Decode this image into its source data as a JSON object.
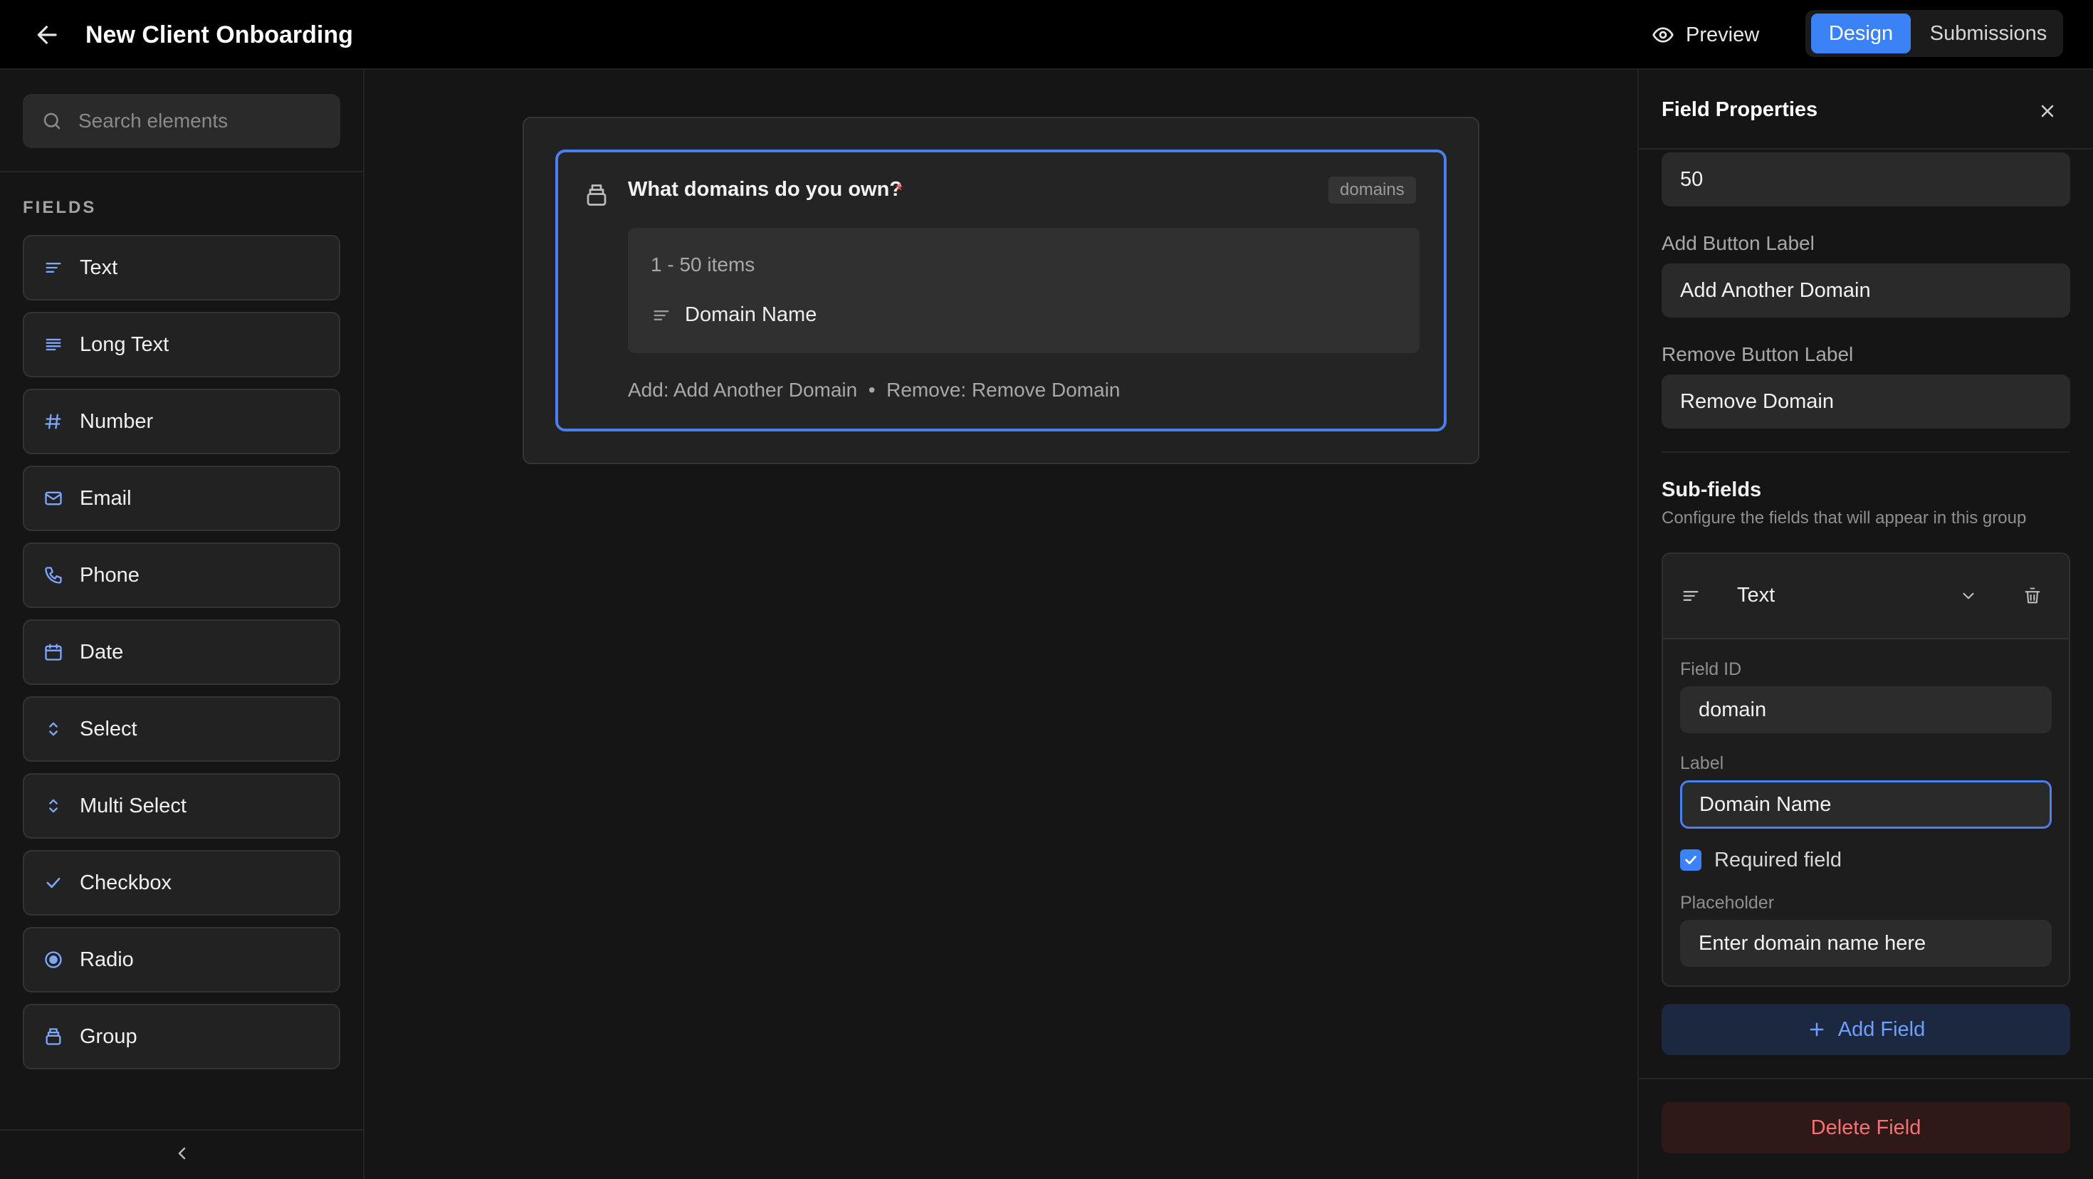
{
  "header": {
    "title": "New Client Onboarding",
    "preview_label": "Preview",
    "tabs": [
      {
        "label": "Design",
        "active": true
      },
      {
        "label": "Submissions",
        "active": false
      }
    ]
  },
  "sidebar": {
    "search_placeholder": "Search elements",
    "section_title": "FIELDS",
    "items": [
      {
        "label": "Text",
        "icon": "text-lines-icon"
      },
      {
        "label": "Long Text",
        "icon": "long-text-icon"
      },
      {
        "label": "Number",
        "icon": "hash-icon"
      },
      {
        "label": "Email",
        "icon": "mail-icon"
      },
      {
        "label": "Phone",
        "icon": "phone-icon"
      },
      {
        "label": "Date",
        "icon": "calendar-icon"
      },
      {
        "label": "Select",
        "icon": "chevrons-updown-icon"
      },
      {
        "label": "Multi Select",
        "icon": "chevrons-updown-icon"
      },
      {
        "label": "Checkbox",
        "icon": "check-icon"
      },
      {
        "label": "Radio",
        "icon": "radio-icon"
      },
      {
        "label": "Group",
        "icon": "group-icon"
      }
    ]
  },
  "canvas": {
    "field": {
      "question": "What domains do you own?",
      "required_mark": "*",
      "field_id": "domains",
      "items_range": "1 - 50 items",
      "subfield_label": "Domain Name",
      "add_remove_text": "Add: Add Another Domain  •  Remove: Remove Domain"
    }
  },
  "panel": {
    "title": "Field Properties",
    "max_items_value": "50",
    "add_button_label_title": "Add Button Label",
    "add_button_label_value": "Add Another Domain",
    "remove_button_label_title": "Remove Button Label",
    "remove_button_label_value": "Remove Domain",
    "subfields_title": "Sub-fields",
    "subfields_desc": "Configure the fields that will appear in this group",
    "subfield": {
      "type": "Text",
      "field_id_title": "Field ID",
      "field_id_value": "domain",
      "label_title": "Label",
      "label_value": "Domain Name",
      "required_text": "Required field",
      "required_checked": true,
      "placeholder_title": "Placeholder",
      "placeholder_value": "Enter domain name here"
    },
    "add_field_label": "Add Field",
    "delete_field_label": "Delete Field"
  },
  "colors": {
    "accent": "#3b82f6",
    "danger": "#f87171",
    "background": "#151515"
  }
}
